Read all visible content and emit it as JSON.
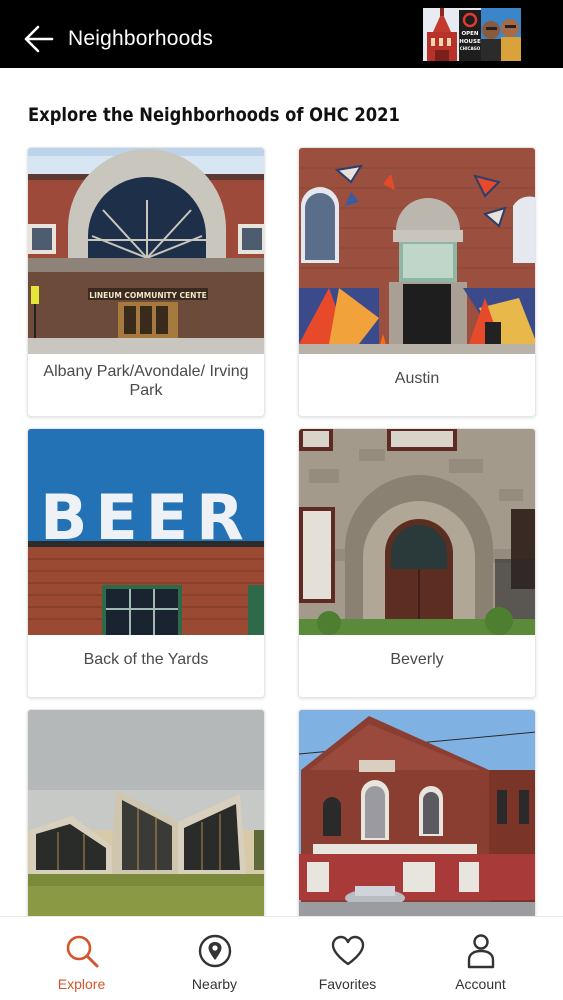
{
  "header": {
    "title": "Neighborhoods",
    "logo_text": [
      "OPEN",
      "HOUSE",
      "CHICAGO"
    ]
  },
  "main": {
    "section_title": "Explore the Neighborhoods of OHC 2021",
    "neighborhoods": [
      {
        "label": "Albany Park/Avondale/ Irving Park",
        "sign_text": "LINEUM COMMUNITY CENTE"
      },
      {
        "label": "Austin"
      },
      {
        "label": "Back of the Yards",
        "sign_text": "BEER"
      },
      {
        "label": "Beverly"
      },
      {
        "label": ""
      },
      {
        "label": ""
      }
    ]
  },
  "bottom_nav": {
    "active": "Explore",
    "items": [
      {
        "label": "Explore",
        "icon": "search-icon"
      },
      {
        "label": "Nearby",
        "icon": "location-pin-icon"
      },
      {
        "label": "Favorites",
        "icon": "heart-icon"
      },
      {
        "label": "Account",
        "icon": "person-icon"
      }
    ]
  },
  "colors": {
    "accent": "#d4552b",
    "header_bg": "#000000",
    "nav_text": "#333333"
  }
}
